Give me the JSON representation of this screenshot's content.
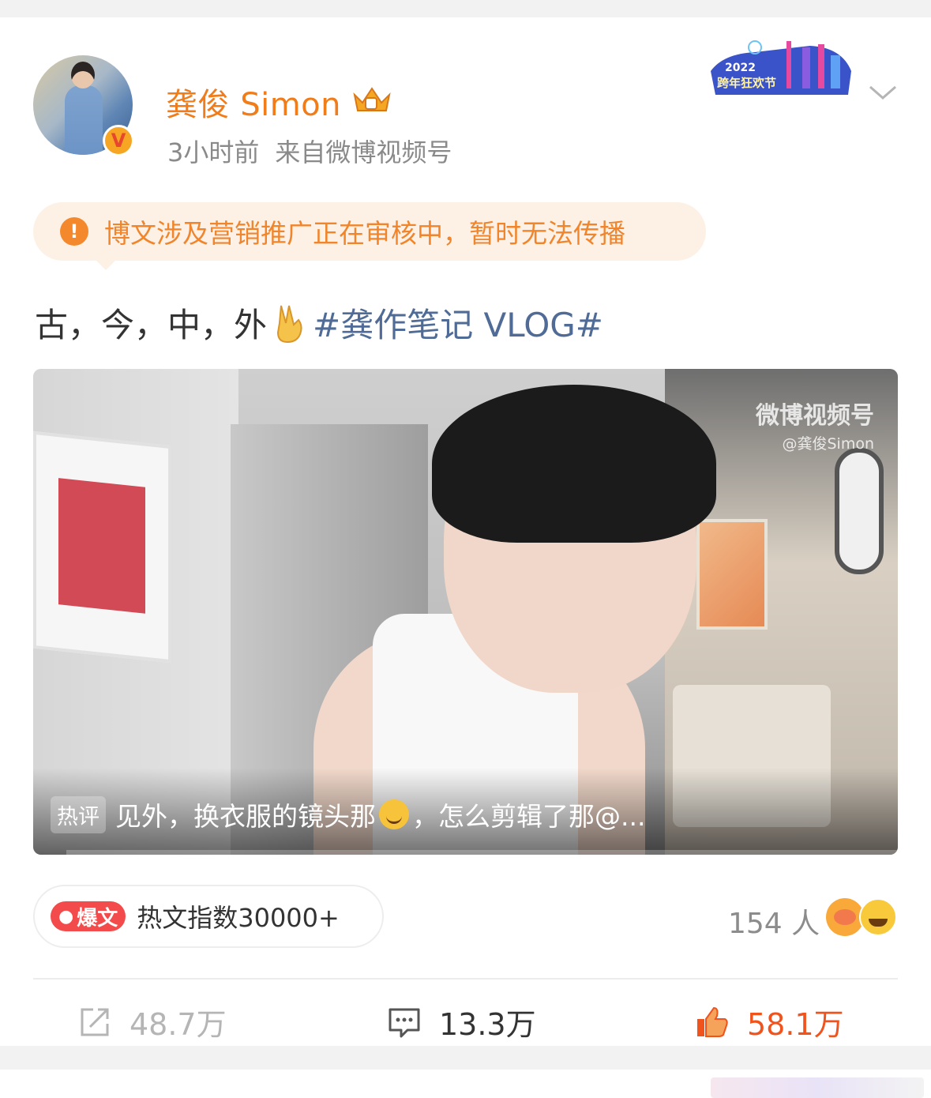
{
  "post": {
    "username": "龚俊 Simon",
    "time": "3小时前",
    "source": "来自微博视频号",
    "notice": "博文涉及营销推广正在审核中，暂时无法传播",
    "text_main": "古，今，中，外",
    "hashtag": "#龚作笔记 VLOG#"
  },
  "banner": {
    "year": "2022",
    "title": "跨年狂欢节"
  },
  "video": {
    "watermark_main": "微博视频号",
    "watermark_sub": "@龚俊Simon",
    "hot_tag": "热评",
    "hot_comment_before": "见外，换衣服的镜头那",
    "hot_comment_after": "，怎么剪辑了那@..."
  },
  "stats": {
    "boom_label": "爆文",
    "hot_index": "热文指数30000+",
    "reaction_count": "154 人",
    "share": "48.7万",
    "comments": "13.3万",
    "likes": "58.1万"
  },
  "colors": {
    "username": "#f07c1a",
    "hashtag": "#4f6b96",
    "like": "#f0531c",
    "notice_bg": "#fdf1e6"
  },
  "icons": [
    "verified-v-icon",
    "crown-icon",
    "chevron-down-icon",
    "info-icon",
    "victory-hand-icon",
    "fire-icon",
    "share-icon",
    "comment-icon",
    "like-thumb-icon"
  ]
}
